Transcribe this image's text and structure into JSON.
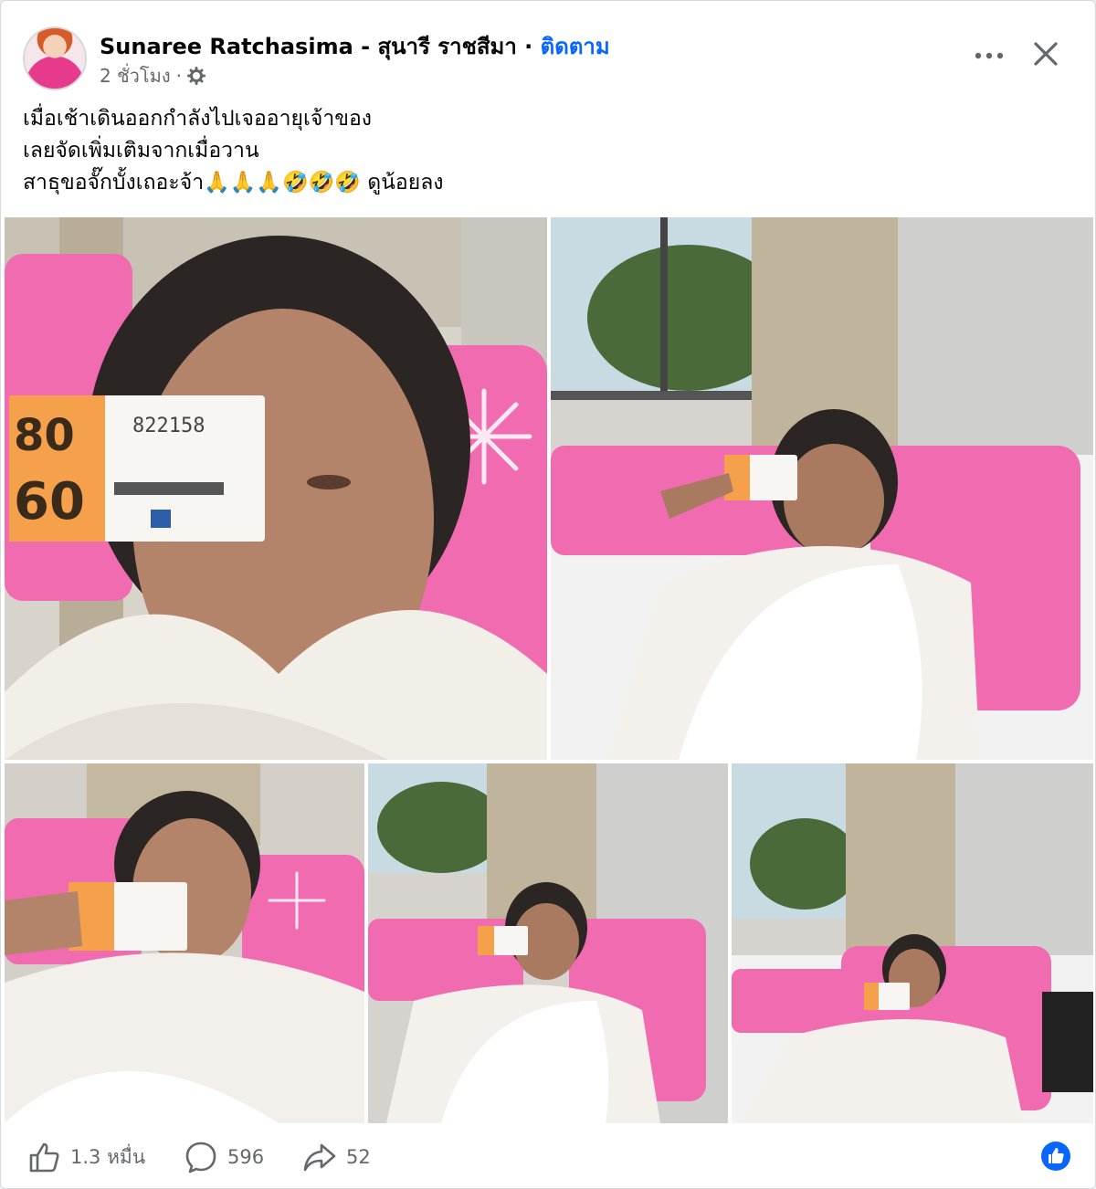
{
  "header": {
    "author_name": "Sunaree Ratchasima - สุนารี ราชสีมา",
    "separator": " · ",
    "follow_label": "ติดตาม",
    "timestamp": "2 ชั่วโมง",
    "meta_dot": "·",
    "privacy_icon": "gear-icon",
    "more_icon": "more-dots-icon",
    "close_icon": "close-icon"
  },
  "post": {
    "lines": [
      "เมื่อเช้าเดินออกกำลังไปเจออายุเจ้าของ",
      "เลยจัดเพิ่มเติมจากเมื่อวาน",
      "สาธุขอจั๊กบั้งเถอะจ้า🙏🙏🙏🤣🤣🤣 ดูน้อยลง"
    ]
  },
  "photos": {
    "count": 5,
    "ticket_number": "822158",
    "ticket_price": "80",
    "ticket_price_large": "60"
  },
  "footer": {
    "likes": "1.3 หมื่น",
    "comments": "596",
    "shares": "52",
    "like_icon": "thumbs-up-icon",
    "comment_icon": "comment-bubble-icon",
    "share_icon": "share-arrow-icon",
    "reaction_icon": "like-reaction-icon"
  },
  "colors": {
    "accent": "#0866ff",
    "muted_text": "#65676b",
    "pillow_pink": "#f06bb0",
    "ticket_orange": "#f5a04a"
  }
}
